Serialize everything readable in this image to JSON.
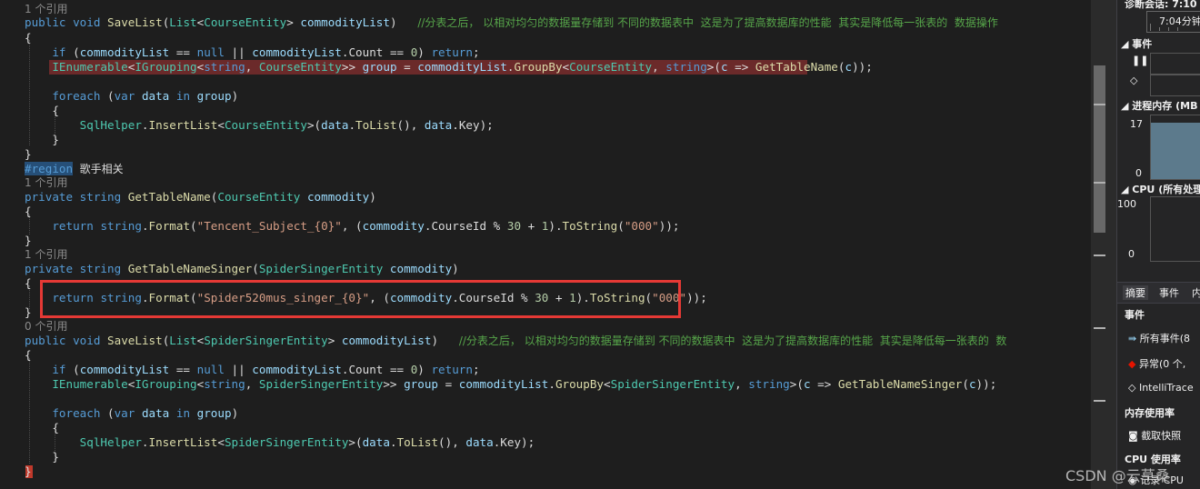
{
  "editor": {
    "lens": {
      "ref1": "1 个引用",
      "ref0": "0 个引用"
    },
    "comment_line1": "//分表之后， 以相对均匀的数据量存储到 不同的数据表中  这是为了提高数据库的性能  其实是降低每一张表的  数据操作",
    "comment_line2": "//分表之后， 以相对均匀的数据量存储到 不同的数据表中  这是为了提高数据库的性能  其实是降低每一张表的  数",
    "region_text": "歌手相关",
    "method_savelist": "SaveList",
    "method_gettablename": "GetTableName",
    "method_gettablenamesinger": "GetTableNameSinger",
    "string_subject": "\"Tencent_Subject_{0}\"",
    "string_singer": "\"Spider520mus_singer_{0}\"",
    "string_fmt": "\"000\"",
    "num_zero": "0",
    "num_thirty": "30",
    "num_one": "1"
  },
  "diagnostics": {
    "session_label": "诊断会话: 7:10",
    "time_label": "7:04分钟",
    "events_header": "事件",
    "memory_header": "进程内存 (MB",
    "memory_max": "17",
    "memory_min": "0",
    "cpu_header": "CPU (所有处理",
    "cpu_max": "100",
    "cpu_min": "0",
    "tabs": [
      "摘要",
      "事件",
      "内"
    ],
    "summary_events_header": "事件",
    "all_events": "所有事件(8",
    "exceptions": "异常(0 个,",
    "intellitrace": "IntelliTrace",
    "memory_usage_header": "内存使用率",
    "snapshot": "截取快照",
    "cpu_usage_header": "CPU 使用率",
    "record_cpu": "记录 CPU"
  },
  "watermark": "CSDN @云草桑",
  "colors": {
    "editor_bg": "#1e1e1e",
    "keyword": "#569cd6",
    "type": "#4ec9b0",
    "string": "#d69d85",
    "comment": "#57a64a",
    "highlight_box": "#e53935",
    "error_line": "#6b2a2a"
  }
}
